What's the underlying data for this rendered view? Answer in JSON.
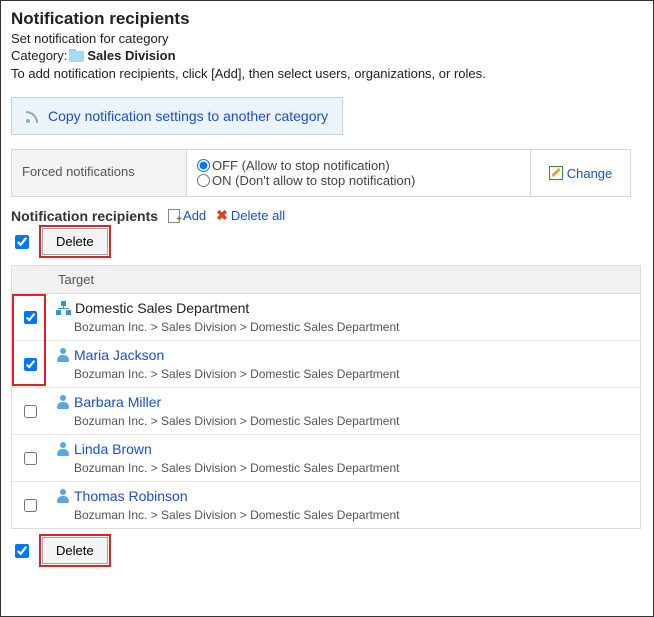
{
  "heading": "Notification recipients",
  "subtitle": "Set notification for category",
  "category_label": "Category:",
  "category_name": "Sales Division",
  "instruction": "To add notification recipients, click [Add], then select users, organizations, or roles.",
  "copy_link": "Copy notification settings to another category",
  "forced": {
    "label": "Forced notifications",
    "off": "OFF (Allow to stop notification)",
    "on": "ON (Don't allow to stop notification)",
    "change": "Change"
  },
  "section": {
    "title": "Notification recipients",
    "add": "Add",
    "delete_all": "Delete all"
  },
  "buttons": {
    "delete": "Delete"
  },
  "table": {
    "header_target": "Target"
  },
  "rows": [
    {
      "type": "org",
      "name": "Domestic Sales Department",
      "path": "Bozuman Inc. > Sales Division > Domestic Sales Department",
      "checked": true
    },
    {
      "type": "user",
      "name": "Maria Jackson",
      "path": "Bozuman Inc. > Sales Division > Domestic Sales Department",
      "checked": true
    },
    {
      "type": "user",
      "name": "Barbara Miller",
      "path": "Bozuman Inc. > Sales Division > Domestic Sales Department",
      "checked": false
    },
    {
      "type": "user",
      "name": "Linda Brown",
      "path": "Bozuman Inc. > Sales Division > Domestic Sales Department",
      "checked": false
    },
    {
      "type": "user",
      "name": "Thomas Robinson",
      "path": "Bozuman Inc. > Sales Division > Domestic Sales Department",
      "checked": false
    }
  ]
}
